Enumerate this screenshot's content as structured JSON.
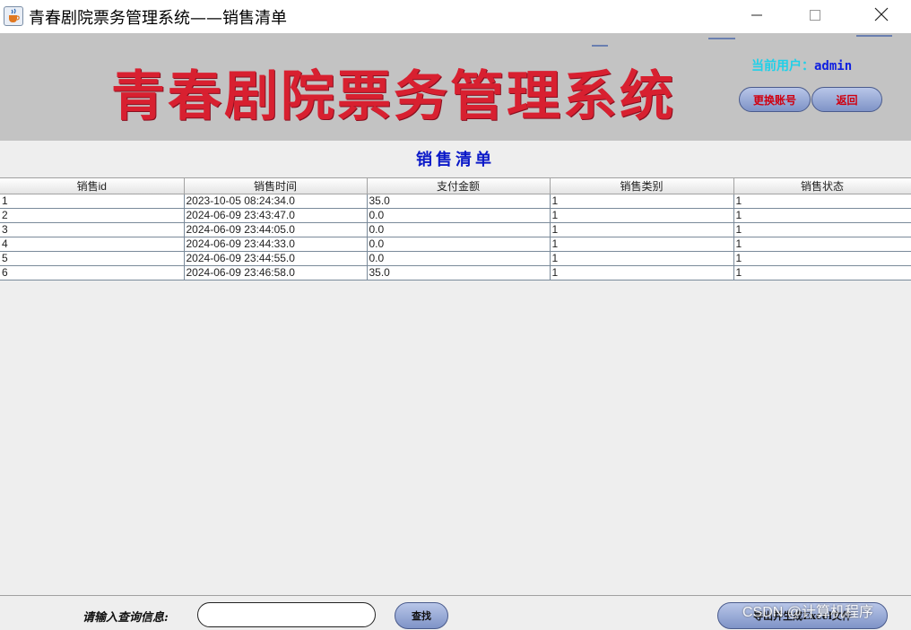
{
  "window": {
    "title": "青春剧院票务管理系统——销售清单",
    "icon": "java-cup-icon"
  },
  "banner": {
    "title": "青春剧院票务管理系统",
    "user_label": "当前用户：",
    "user_name": "admin",
    "switch_account_label": "更换账号",
    "back_label": "返回"
  },
  "section_title": "销售清单",
  "table": {
    "columns": [
      "销售id",
      "销售时间",
      "支付金额",
      "销售类别",
      "销售状态"
    ],
    "rows": [
      [
        "1",
        "2023-10-05 08:24:34.0",
        "35.0",
        "1",
        "1"
      ],
      [
        "2",
        "2024-06-09 23:43:47.0",
        "0.0",
        "1",
        "1"
      ],
      [
        "3",
        "2024-06-09 23:44:05.0",
        "0.0",
        "1",
        "1"
      ],
      [
        "4",
        "2024-06-09 23:44:33.0",
        "0.0",
        "1",
        "1"
      ],
      [
        "5",
        "2024-06-09 23:44:55.0",
        "0.0",
        "1",
        "1"
      ],
      [
        "6",
        "2024-06-09 23:46:58.0",
        "35.0",
        "1",
        "1"
      ]
    ]
  },
  "search": {
    "label": "请输入查询信息:",
    "value": "",
    "find_label": "查找",
    "export_label": "导出并生成Excel文件"
  },
  "watermark": "CSDN @计算机程序",
  "colors": {
    "banner_bg": "#c3c3c3",
    "title_red": "#d82030",
    "heading_blue": "#0a18c8",
    "button_blue": "#8fa2d2"
  }
}
